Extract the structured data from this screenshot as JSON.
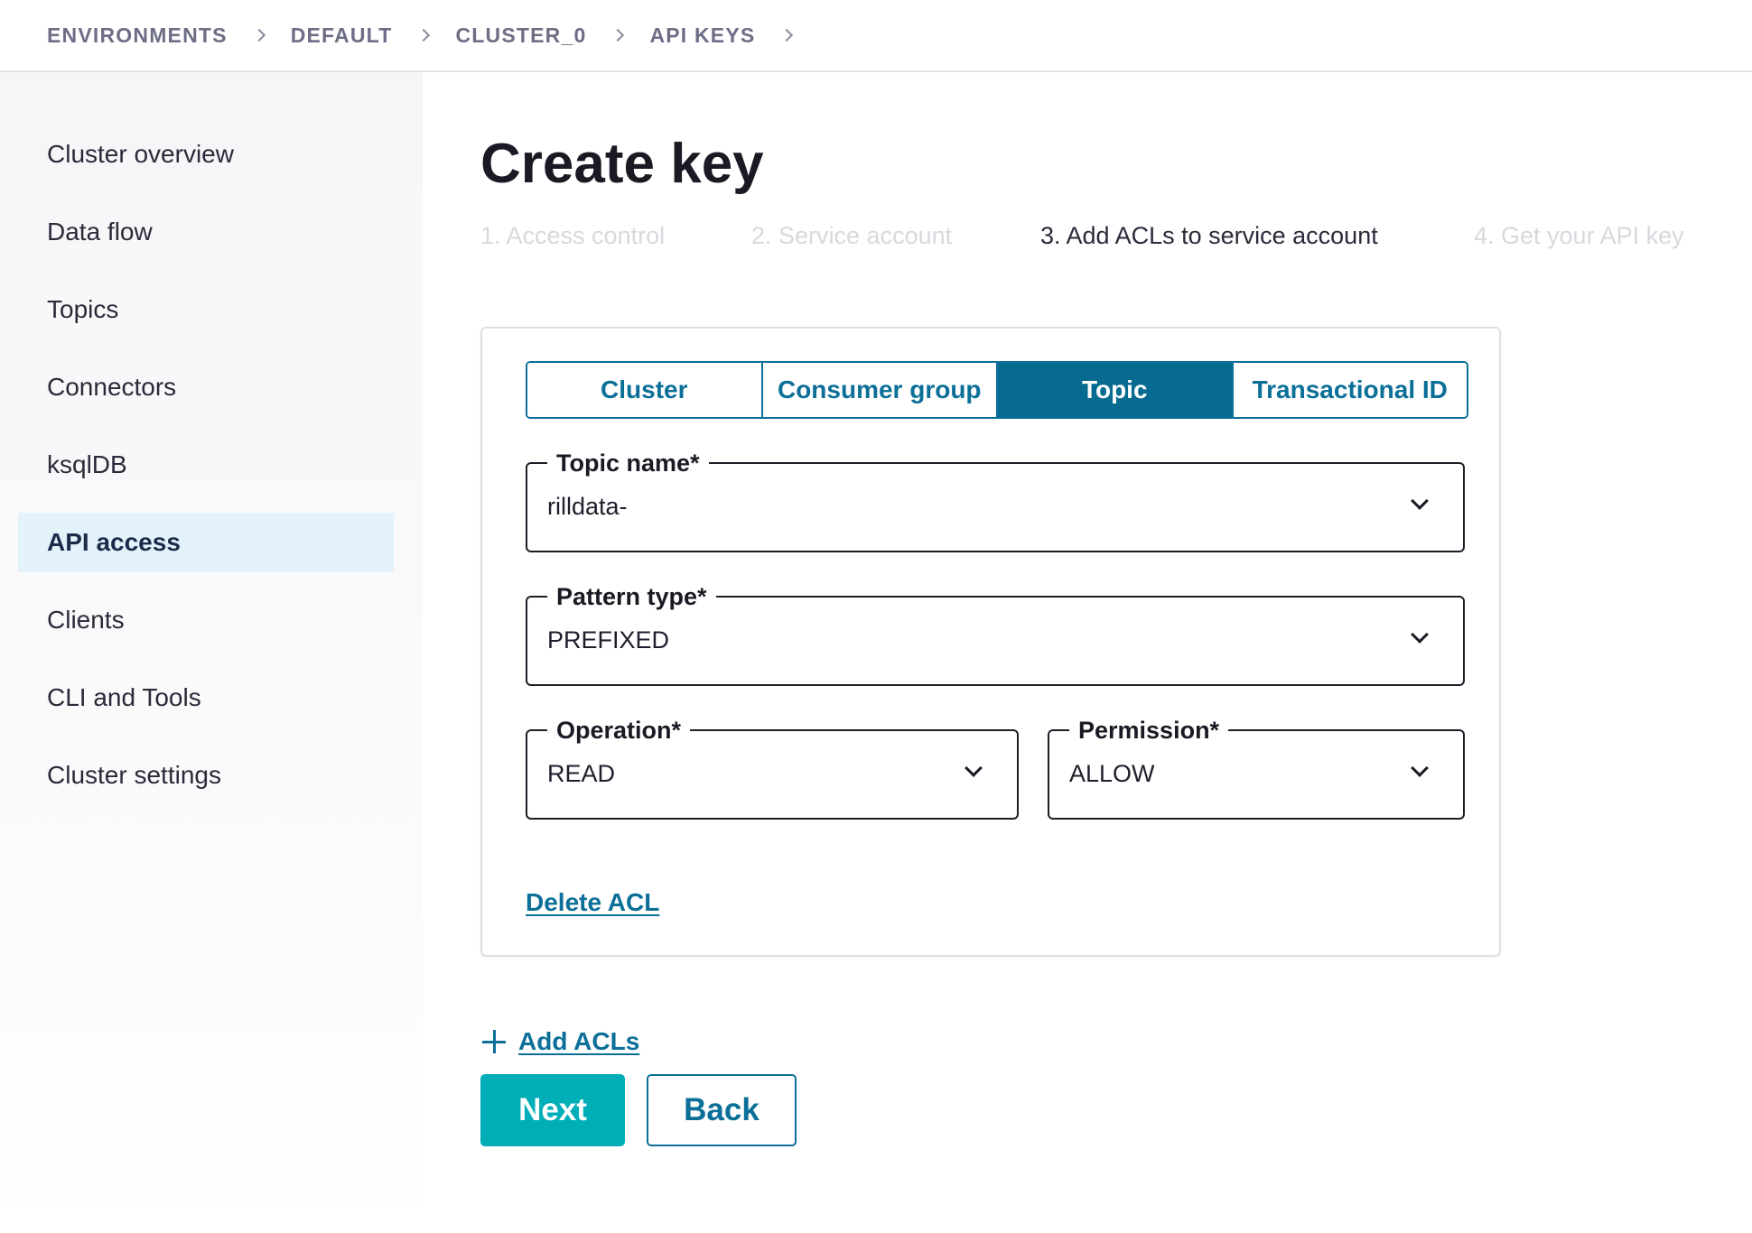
{
  "breadcrumb": [
    "ENVIRONMENTS",
    "DEFAULT",
    "CLUSTER_0",
    "API KEYS"
  ],
  "sidebar": {
    "items": [
      {
        "label": "Cluster overview"
      },
      {
        "label": "Data flow"
      },
      {
        "label": "Topics"
      },
      {
        "label": "Connectors"
      },
      {
        "label": "ksqlDB"
      },
      {
        "label": "API access",
        "active": true
      },
      {
        "label": "Clients"
      },
      {
        "label": "CLI and Tools"
      },
      {
        "label": "Cluster settings"
      }
    ]
  },
  "main": {
    "title": "Create key",
    "steps": [
      {
        "label": "1. Access control",
        "state": "inactive"
      },
      {
        "label": "2. Service account",
        "state": "inactive"
      },
      {
        "label": "3. Add ACLs to service account",
        "state": "current"
      },
      {
        "label": "4. Get your API key",
        "state": "inactive"
      }
    ]
  },
  "acl_card": {
    "resource_tabs": [
      {
        "label": "Cluster"
      },
      {
        "label": "Consumer group"
      },
      {
        "label": "Topic",
        "selected": true
      },
      {
        "label": "Transactional ID"
      }
    ],
    "topic_name": {
      "label": "Topic name*",
      "value": "rilldata-"
    },
    "pattern_type": {
      "label": "Pattern type*",
      "value": "PREFIXED"
    },
    "operation": {
      "label": "Operation*",
      "value": "READ"
    },
    "permission": {
      "label": "Permission*",
      "value": "ALLOW"
    },
    "delete_label": "Delete ACL"
  },
  "actions": {
    "add_acls_label": "Add ACLs",
    "next_label": "Next",
    "back_label": "Back"
  },
  "colors": {
    "accent": "#0b6f98",
    "primary_button": "#00aeb8",
    "active_nav_bg": "#e4f3fb"
  }
}
